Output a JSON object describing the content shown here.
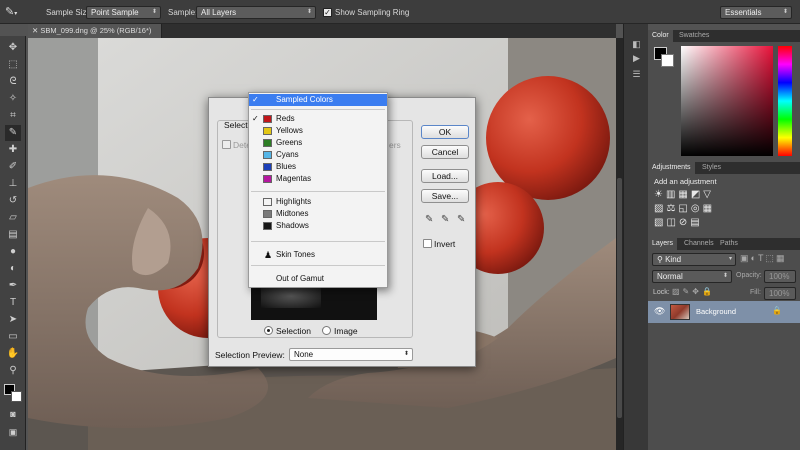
{
  "options_bar": {
    "sample_size_label": "Sample Size:",
    "sample_size_value": "Point Sample",
    "sample_label": "Sample:",
    "sample_value": "All Layers",
    "show_sampling_ring_label": "Show Sampling Ring",
    "workspace": "Essentials"
  },
  "document_tab": "SBM_099.dng @ 25% (RGB/16*)",
  "panels": {
    "color_tabs": [
      "Color",
      "Swatches"
    ],
    "adjustments_tabs": [
      "Adjustments",
      "Styles"
    ],
    "add_adjustment_label": "Add an adjustment",
    "layers_tabs": [
      "Layers",
      "Channels",
      "Paths"
    ],
    "filter_kind": "Kind",
    "blend_mode": "Normal",
    "opacity_label": "Opacity:",
    "opacity_value": "100%",
    "lock_label": "Lock:",
    "fill_label": "Fill:",
    "fill_value": "100%",
    "layer_name": "Background"
  },
  "dialog": {
    "select_label": "Select",
    "detect_faces_label": "Dete",
    "clusters_label": "ers",
    "ok": "OK",
    "cancel": "Cancel",
    "load": "Load...",
    "save": "Save...",
    "invert": "Invert",
    "radio_selection": "Selection",
    "radio_image": "Image",
    "selection_preview_label": "Selection Preview:",
    "selection_preview_value": "None"
  },
  "menu": {
    "items": [
      {
        "label": "Sampled Colors",
        "checked": false,
        "highlighted": true,
        "swatch": ""
      },
      {
        "label": "Reds",
        "checked": true,
        "highlighted": false,
        "swatch": "#c0161b"
      },
      {
        "label": "Yellows",
        "checked": false,
        "highlighted": false,
        "swatch": "#e3c715"
      },
      {
        "label": "Greens",
        "checked": false,
        "highlighted": false,
        "swatch": "#2c7d24"
      },
      {
        "label": "Cyans",
        "checked": false,
        "highlighted": false,
        "swatch": "#55b5e6"
      },
      {
        "label": "Blues",
        "checked": false,
        "highlighted": false,
        "swatch": "#1b3fb8"
      },
      {
        "label": "Magentas",
        "checked": false,
        "highlighted": false,
        "swatch": "#b5179f"
      },
      {
        "label": "Highlights",
        "checked": false,
        "highlighted": false,
        "swatch": "#f4f4f4"
      },
      {
        "label": "Midtones",
        "checked": false,
        "highlighted": false,
        "swatch": "#7a7a7a"
      },
      {
        "label": "Shadows",
        "checked": false,
        "highlighted": false,
        "swatch": "#161616"
      },
      {
        "label": "Skin Tones",
        "checked": false,
        "highlighted": false,
        "swatch": ""
      },
      {
        "label": "Out of Gamut",
        "checked": false,
        "highlighted": false,
        "swatch": ""
      }
    ]
  },
  "colors": {
    "menu_highlight": "#3b7df0",
    "ui_dark": "#535353"
  }
}
